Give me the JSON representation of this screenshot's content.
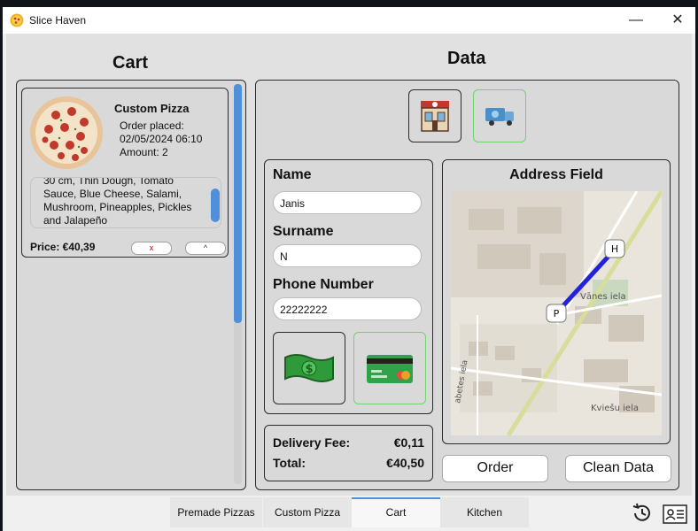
{
  "window": {
    "title": "Slice Haven",
    "minimize_glyph": "—",
    "close_glyph": "✕"
  },
  "cart": {
    "heading": "Cart",
    "item": {
      "name": "Custom Pizza",
      "order_label": "Order placed:",
      "order_time": "02/05/2024 06:10",
      "amount": "Amount: 2",
      "description": "30 cm, Thin Dough, Tomato Sauce, Blue Cheese, Salami, Mushroom, Pineapples, Pickles and Jalapeño",
      "price": "Price: €40,39",
      "remove_label": "x",
      "up_label": "^"
    }
  },
  "data": {
    "heading": "Data",
    "name_label": "Name",
    "name_value": "Janis",
    "surname_label": "Surname",
    "surname_value": "N",
    "phone_label": "Phone Number",
    "phone_value": "22222222",
    "address_label": "Address Field",
    "map_labels": {
      "street1": "Vānes iela",
      "street2": "Kviešu iela",
      "street3": "abetes iela",
      "marker_p": "P",
      "marker_h": "H"
    },
    "delivery_fee_label": "Delivery Fee:",
    "delivery_fee_value": "€0,11",
    "total_label": "Total:",
    "total_value": "€40,50",
    "order_button": "Order",
    "clean_button": "Clean Data"
  },
  "tabs": [
    "Premade Pizzas",
    "Custom Pizza",
    "Cart",
    "Kitchen"
  ],
  "active_tab": "Cart",
  "colors": {
    "accent": "#4f90d9",
    "selected_border": "#6fd36f",
    "route": "#2222dd"
  },
  "icons": [
    "pizza-app-icon",
    "store-icon",
    "delivery-truck-icon",
    "cash-icon",
    "credit-card-icon",
    "history-icon",
    "account-card-icon"
  ]
}
